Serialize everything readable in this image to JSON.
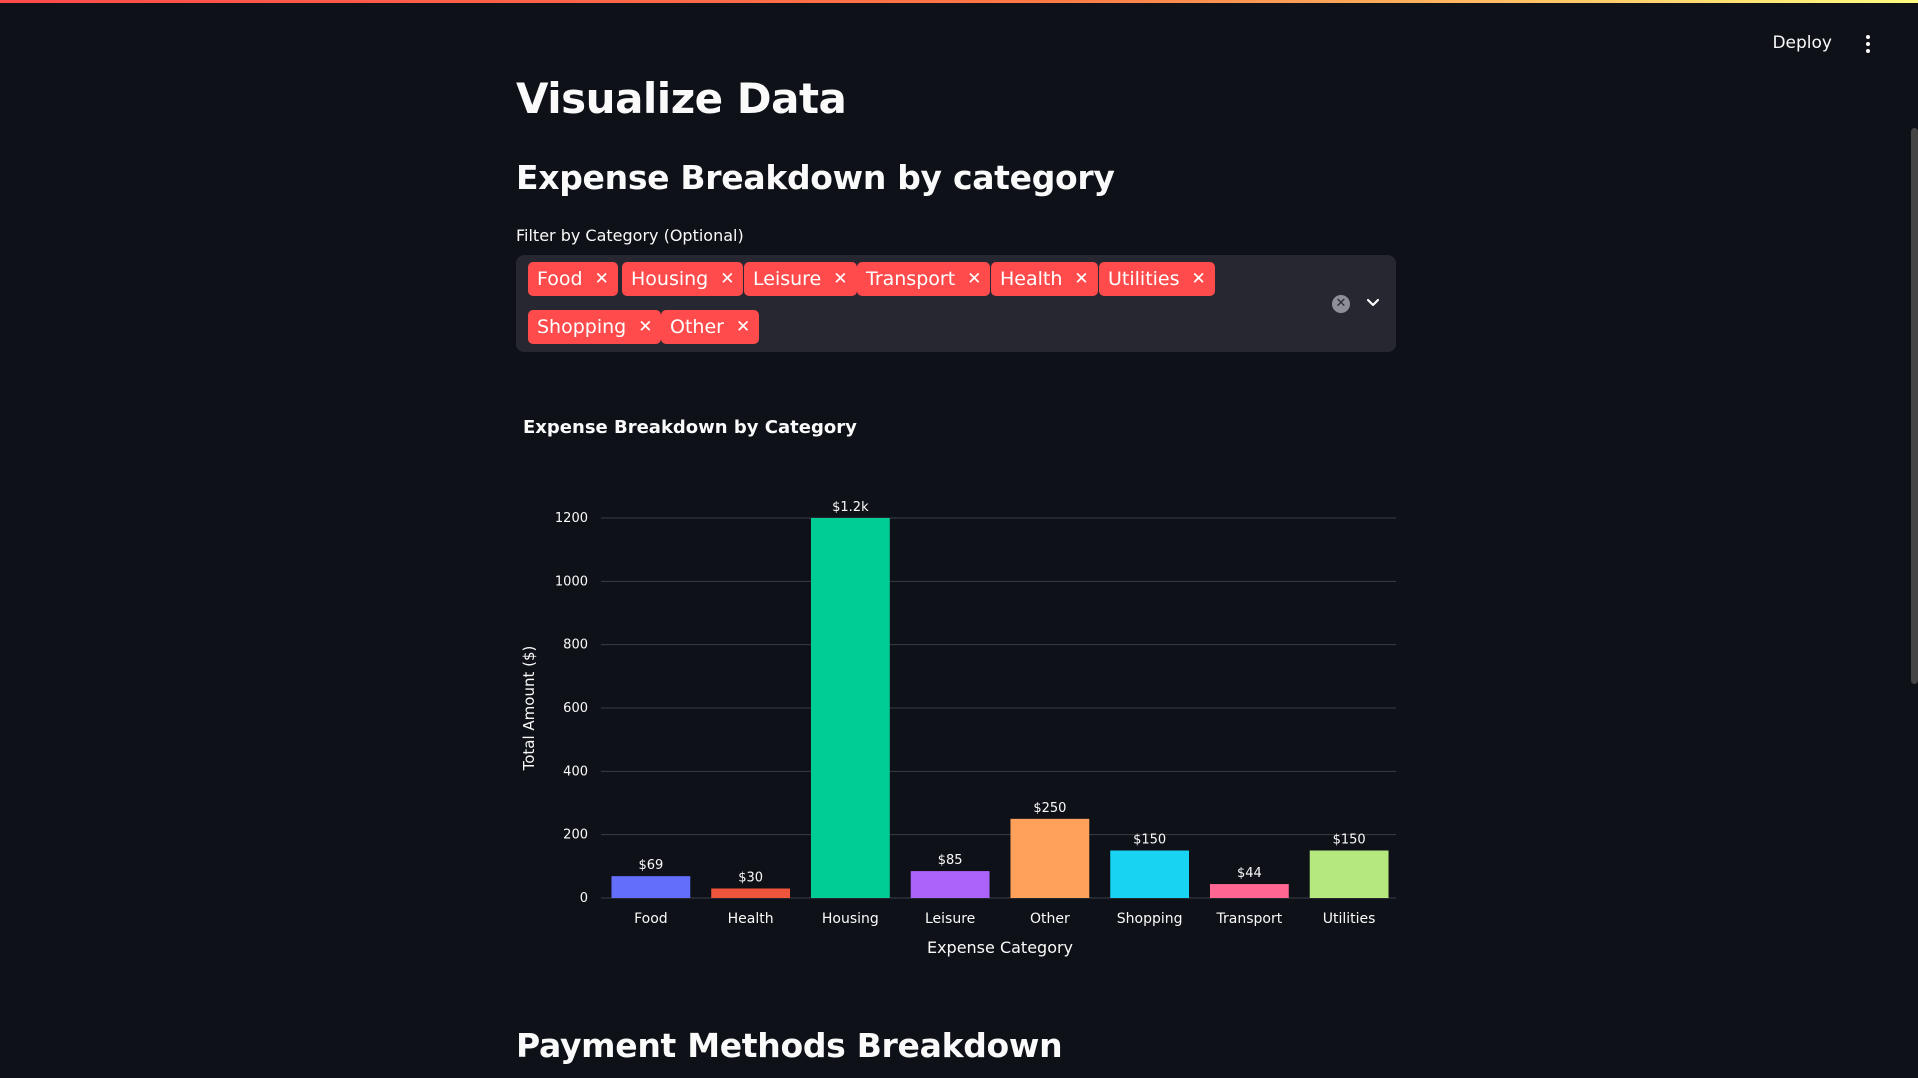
{
  "header": {
    "deploy_label": "Deploy",
    "menu_icon": "kebab-menu-icon"
  },
  "main": {
    "title": "Visualize Data",
    "subtitle": "Expense Breakdown by category",
    "filter": {
      "label": "Filter by Category (Optional)",
      "selected": [
        "Food",
        "Housing",
        "Leisure",
        "Transport",
        "Health",
        "Utilities",
        "Shopping",
        "Other"
      ],
      "chip_color": "#ff4b4b"
    },
    "next_section_title": "Payment Methods Breakdown"
  },
  "chart_data": {
    "type": "bar",
    "title": "Expense Breakdown by Category",
    "xlabel": "Expense Category",
    "ylabel": "Total Amount ($)",
    "categories": [
      "Food",
      "Health",
      "Housing",
      "Leisure",
      "Other",
      "Shopping",
      "Transport",
      "Utilities"
    ],
    "values": [
      69,
      30,
      1200,
      85,
      250,
      150,
      44,
      150
    ],
    "data_labels": [
      "$69",
      "$30",
      "$1.2k",
      "$85",
      "$250",
      "$150",
      "$44",
      "$150"
    ],
    "colors": [
      "#636efa",
      "#ef553b",
      "#00cc96",
      "#ab63fa",
      "#ffa15a",
      "#19d3f3",
      "#ff6692",
      "#b6e880"
    ],
    "yticks": [
      0,
      200,
      400,
      600,
      800,
      1000,
      1200
    ],
    "ylim": [
      0,
      1200
    ],
    "grid": true
  }
}
